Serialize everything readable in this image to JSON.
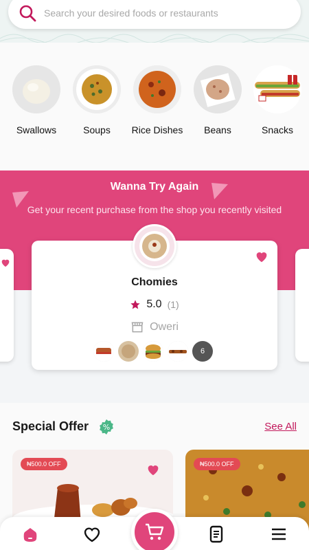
{
  "search": {
    "placeholder": "Search your desired foods or restaurants"
  },
  "categories": [
    {
      "label": "Swallows"
    },
    {
      "label": "Soups"
    },
    {
      "label": "Rice Dishes"
    },
    {
      "label": "Beans"
    },
    {
      "label": "Snacks"
    }
  ],
  "promo": {
    "title": "Wanna Try Again",
    "subtitle": "Get your recent purchase from the shop you recently visited"
  },
  "shop": {
    "name": "Chomies",
    "rating": "5.0",
    "rating_count": "(1)",
    "location": "Oweri",
    "more_items": "6"
  },
  "special_offer": {
    "title": "Special Offer",
    "see_all": "See All",
    "offers": [
      {
        "discount": "₦500.0 OFF"
      },
      {
        "discount": "₦500.0 OFF"
      }
    ]
  },
  "colors": {
    "brand": "#e0457b",
    "offer_badge": "#e34a54",
    "link": "#c2185b",
    "discount_badge": "#4bb788"
  }
}
